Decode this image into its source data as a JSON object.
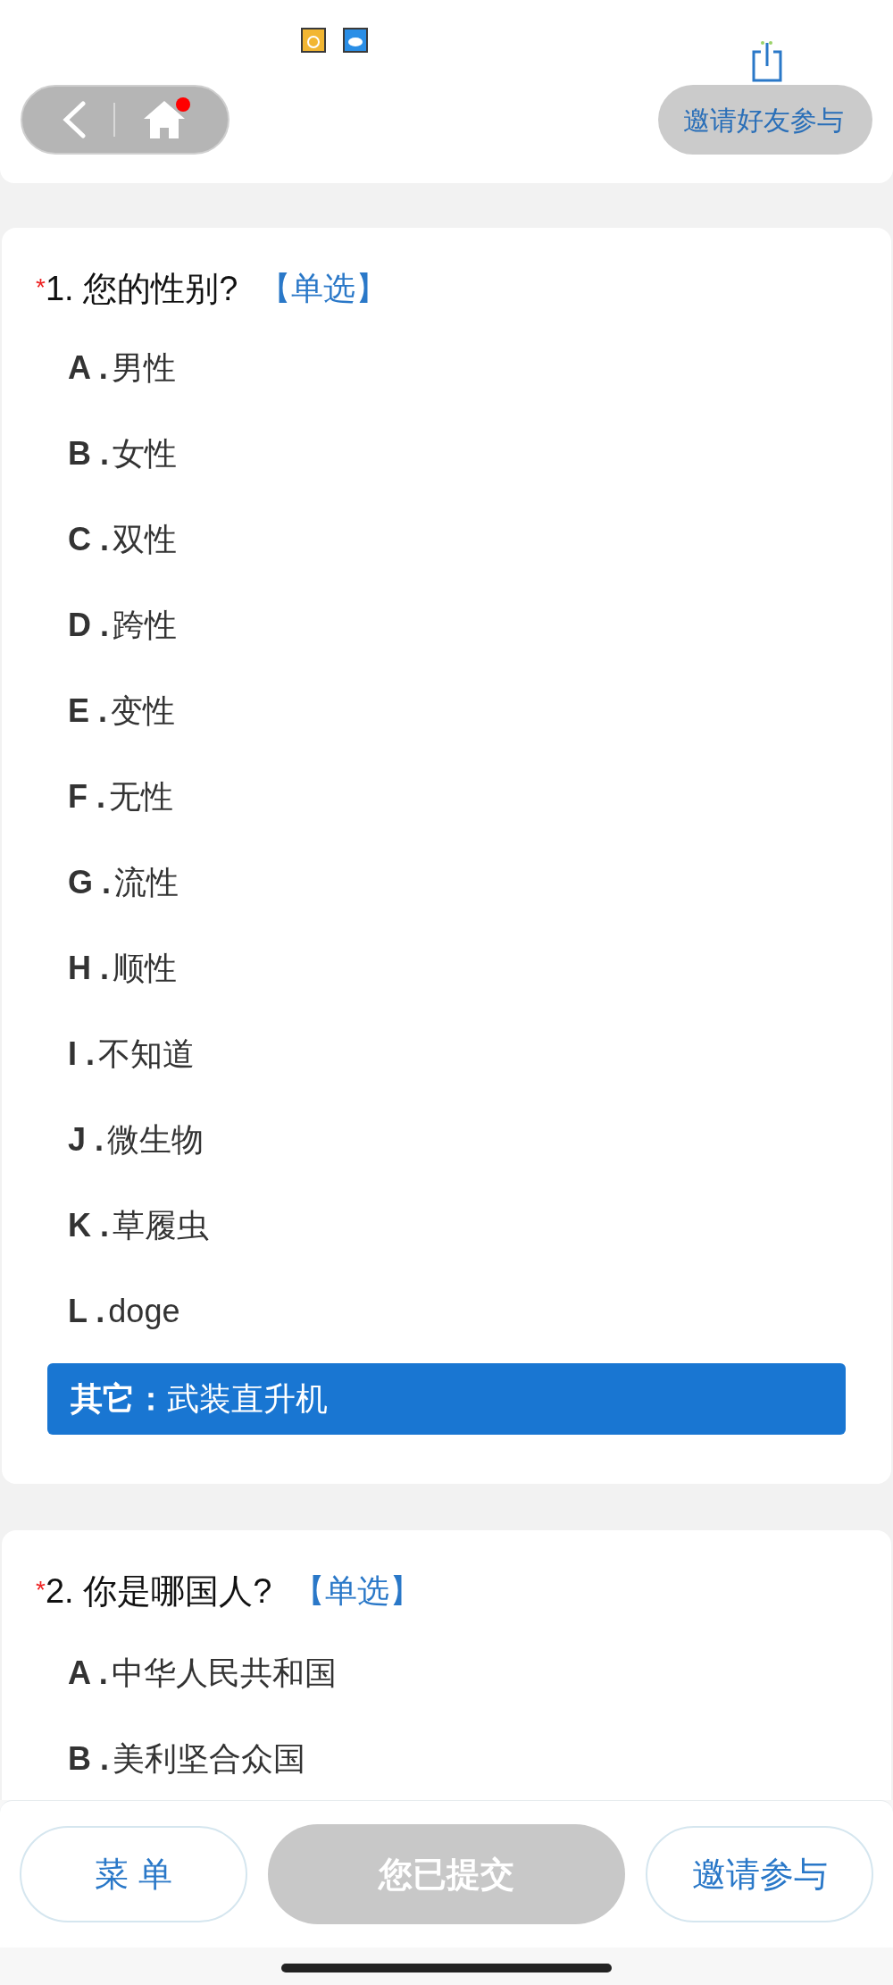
{
  "header": {
    "notification_dot": true,
    "invite_button": "邀请好友参与"
  },
  "questions": [
    {
      "required_mark": "*",
      "title": "1. 您的性别?",
      "type_tag": "【单选】",
      "options": [
        {
          "letter": "A .",
          "text": "男性",
          "selected": false
        },
        {
          "letter": "B .",
          "text": "女性",
          "selected": false
        },
        {
          "letter": "C .",
          "text": "双性",
          "selected": false
        },
        {
          "letter": "D .",
          "text": "跨性",
          "selected": false
        },
        {
          "letter": "E .",
          "text": "变性",
          "selected": false
        },
        {
          "letter": "F .",
          "text": "无性",
          "selected": false
        },
        {
          "letter": "G .",
          "text": "流性",
          "selected": false
        },
        {
          "letter": "H .",
          "text": "顺性",
          "selected": false
        },
        {
          "letter": "I .",
          "text": "不知道",
          "selected": false
        },
        {
          "letter": "J .",
          "text": "微生物",
          "selected": false
        },
        {
          "letter": "K .",
          "text": "草履虫",
          "selected": false
        },
        {
          "letter": "L .",
          "text": "doge",
          "selected": false
        }
      ],
      "other": {
        "label": "其它：",
        "value": "武装直升机",
        "selected": true
      }
    },
    {
      "required_mark": "*",
      "title": "2. 你是哪国人?",
      "type_tag": "【单选】",
      "options": [
        {
          "letter": "A .",
          "text": "中华人民共和国",
          "selected": false
        },
        {
          "letter": "B .",
          "text": "美利坚合众国",
          "selected": false
        }
      ]
    }
  ],
  "bottom_buttons": [
    {
      "label": "菜 单",
      "disabled": false
    },
    {
      "label": "您已提交",
      "disabled": true
    },
    {
      "label": "邀请参与",
      "disabled": false
    }
  ]
}
